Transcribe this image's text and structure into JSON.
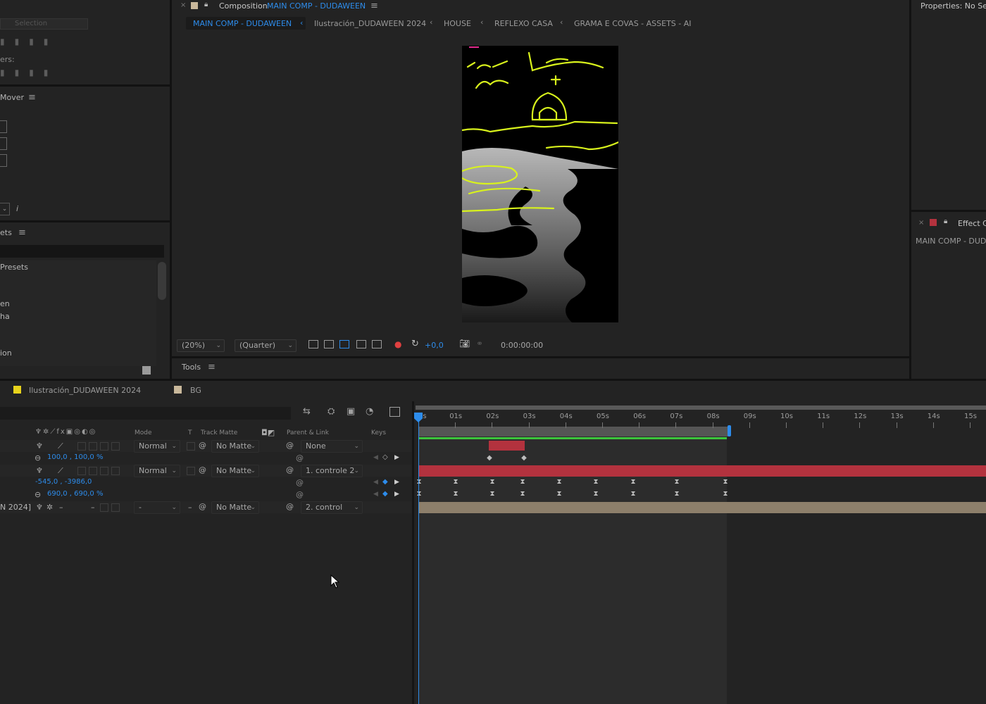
{
  "left_panels": {
    "align_label": "Selection",
    "distribute_label": "ers:",
    "mover_title": "Mover",
    "info_glyph": "i",
    "presets_title": "ets",
    "presets_item": "Presets",
    "list_items": [
      "en",
      "ha",
      "ion"
    ]
  },
  "composition": {
    "panel_label": "Composition",
    "comp_name": "MAIN COMP - DUDAWEEN",
    "breadcrumbs": [
      "MAIN COMP - DUDAWEEN",
      "Ilustración_DUDAWEEN 2024",
      "HOUSE",
      "REFLEXO CASA",
      "GRAMA E COVAS - ASSETS - AI"
    ],
    "zoom": "(20%)",
    "resolution": "(Quarter)",
    "exposure": "+0,0",
    "timecode": "0:00:00:00"
  },
  "tools_title": "Tools",
  "right_panels": {
    "properties_title": "Properties: No Sele",
    "effect_title": "Effect Co",
    "effect_comp": "MAIN COMP - DUD"
  },
  "timeline": {
    "tabs": [
      "Ilustración_DUDAWEEN 2024",
      "BG"
    ],
    "columns": {
      "mode": "Mode",
      "t": "T",
      "track_matte": "Track Matte",
      "parent": "Parent & Link",
      "keys": "Keys"
    },
    "ruler": [
      "0s",
      "01s",
      "02s",
      "03s",
      "04s",
      "05s",
      "06s",
      "07s",
      "08s",
      "09s",
      "10s",
      "11s",
      "12s",
      "13s",
      "14s",
      "15s"
    ],
    "layers": [
      {
        "mode": "Normal",
        "matte": "No Matte",
        "parent": "None",
        "prop_value": "100,0 , 100,0 %"
      },
      {
        "mode": "Normal",
        "matte": "No Matte",
        "parent": "1. controle 2",
        "prop_value_1": "-545,0 , -3986,0",
        "prop_value_2": "690,0 , 690,0 %"
      },
      {
        "name_fragment": "N 2024]",
        "mode": "-",
        "matte": "No Matte",
        "parent": "2. control"
      }
    ]
  },
  "icons": [
    "close-icon",
    "lock-icon",
    "hamburger-icon",
    "chevron-left-icon",
    "camera-icon",
    "mouse-cursor-icon"
  ],
  "colors": {
    "accent_blue": "#2d8ceb",
    "label_yellow": "#e8d31c",
    "label_tan": "#c9b89b",
    "bar_red": "#b3323e",
    "bar_tan": "#8d7f6b",
    "work_area_green": "#3cc43c"
  }
}
